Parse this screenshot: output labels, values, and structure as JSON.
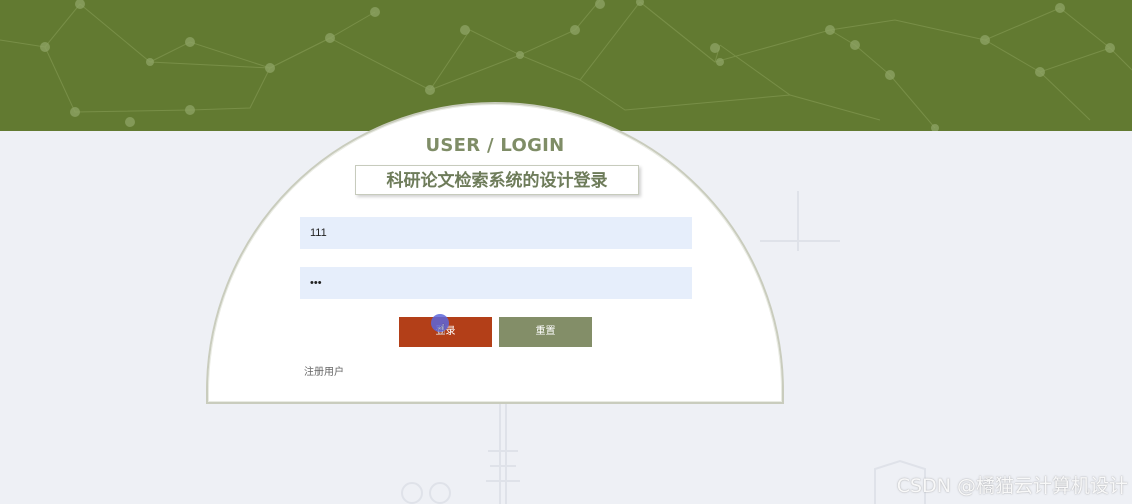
{
  "header": {
    "banner_color": "#627a31"
  },
  "login": {
    "title": "USER / LOGIN",
    "system_name": "科研论文检索系统的设计登录",
    "username_value": "111",
    "password_value": "•••",
    "login_label": "登录",
    "reset_label": "重置",
    "register_label": "注册用户"
  },
  "colors": {
    "login_button": "#b33f18",
    "reset_button": "#838e68",
    "input_bg": "#e6eefb"
  },
  "watermark": {
    "text": "CSDN @橘猫云计算机设计"
  },
  "icons": [
    "pointer-hand-icon"
  ]
}
